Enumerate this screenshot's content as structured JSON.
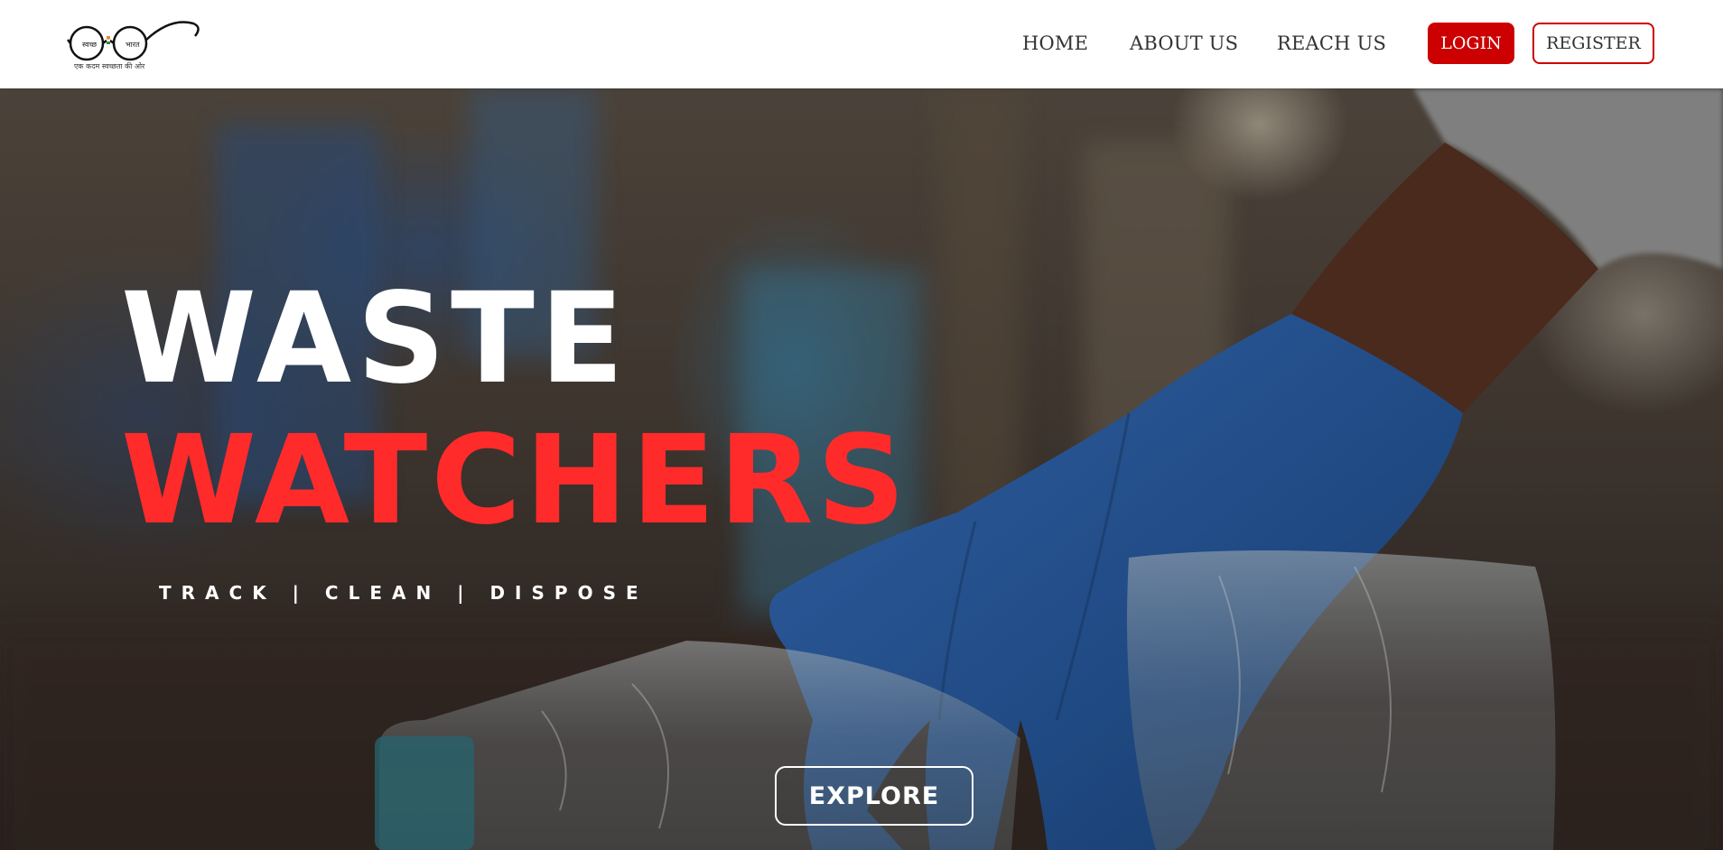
{
  "header": {
    "logo": {
      "left_word": "स्वच्छ",
      "right_word": "भारत",
      "tagline": "एक कदम स्वच्छता की ओर"
    },
    "nav": [
      {
        "label": "HOME"
      },
      {
        "label": "ABOUT US"
      },
      {
        "label": "REACH US"
      }
    ],
    "login_label": "LOGIN",
    "register_label": "REGISTER"
  },
  "hero": {
    "title_line1": "WASTE",
    "title_line2": "WATCHERS",
    "tagline": "TRACK | CLEAN | DISPOSE",
    "explore_label": "EXPLORE"
  },
  "colors": {
    "accent_red": "#cc0000",
    "title_red": "#ff2b2b",
    "glove_blue": "#2d62a8"
  }
}
